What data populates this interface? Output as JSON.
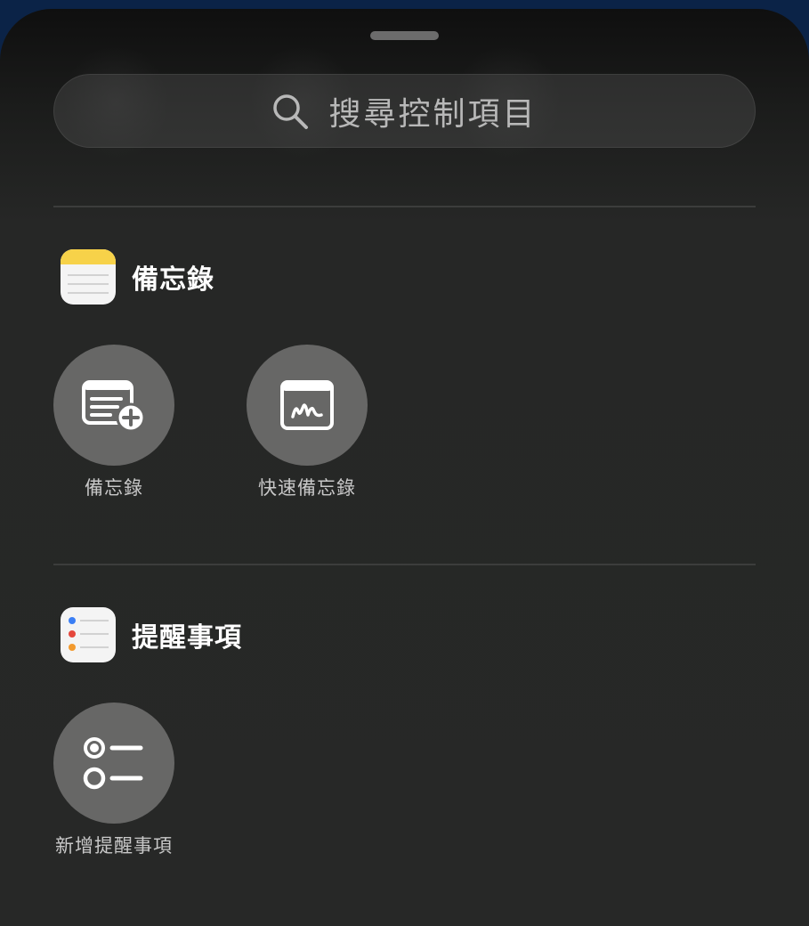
{
  "search": {
    "placeholder": "搜尋控制項目",
    "icon": "search-icon"
  },
  "sections": [
    {
      "app_name": "備忘錄",
      "app_icon": "notes-app-icon",
      "controls": [
        {
          "label": "備忘錄",
          "icon": "new-note-icon"
        },
        {
          "label": "快速備忘錄",
          "icon": "quick-note-icon"
        }
      ]
    },
    {
      "app_name": "提醒事項",
      "app_icon": "reminders-app-icon",
      "controls": [
        {
          "label": "新增提醒事項",
          "icon": "new-reminder-icon"
        }
      ]
    }
  ],
  "colors": {
    "notes_yellow": "#f7d249",
    "reminder_blue": "#3b7ff5",
    "reminder_red": "#e5473c",
    "reminder_orange": "#f29a2e",
    "control_bg": "#676766"
  }
}
